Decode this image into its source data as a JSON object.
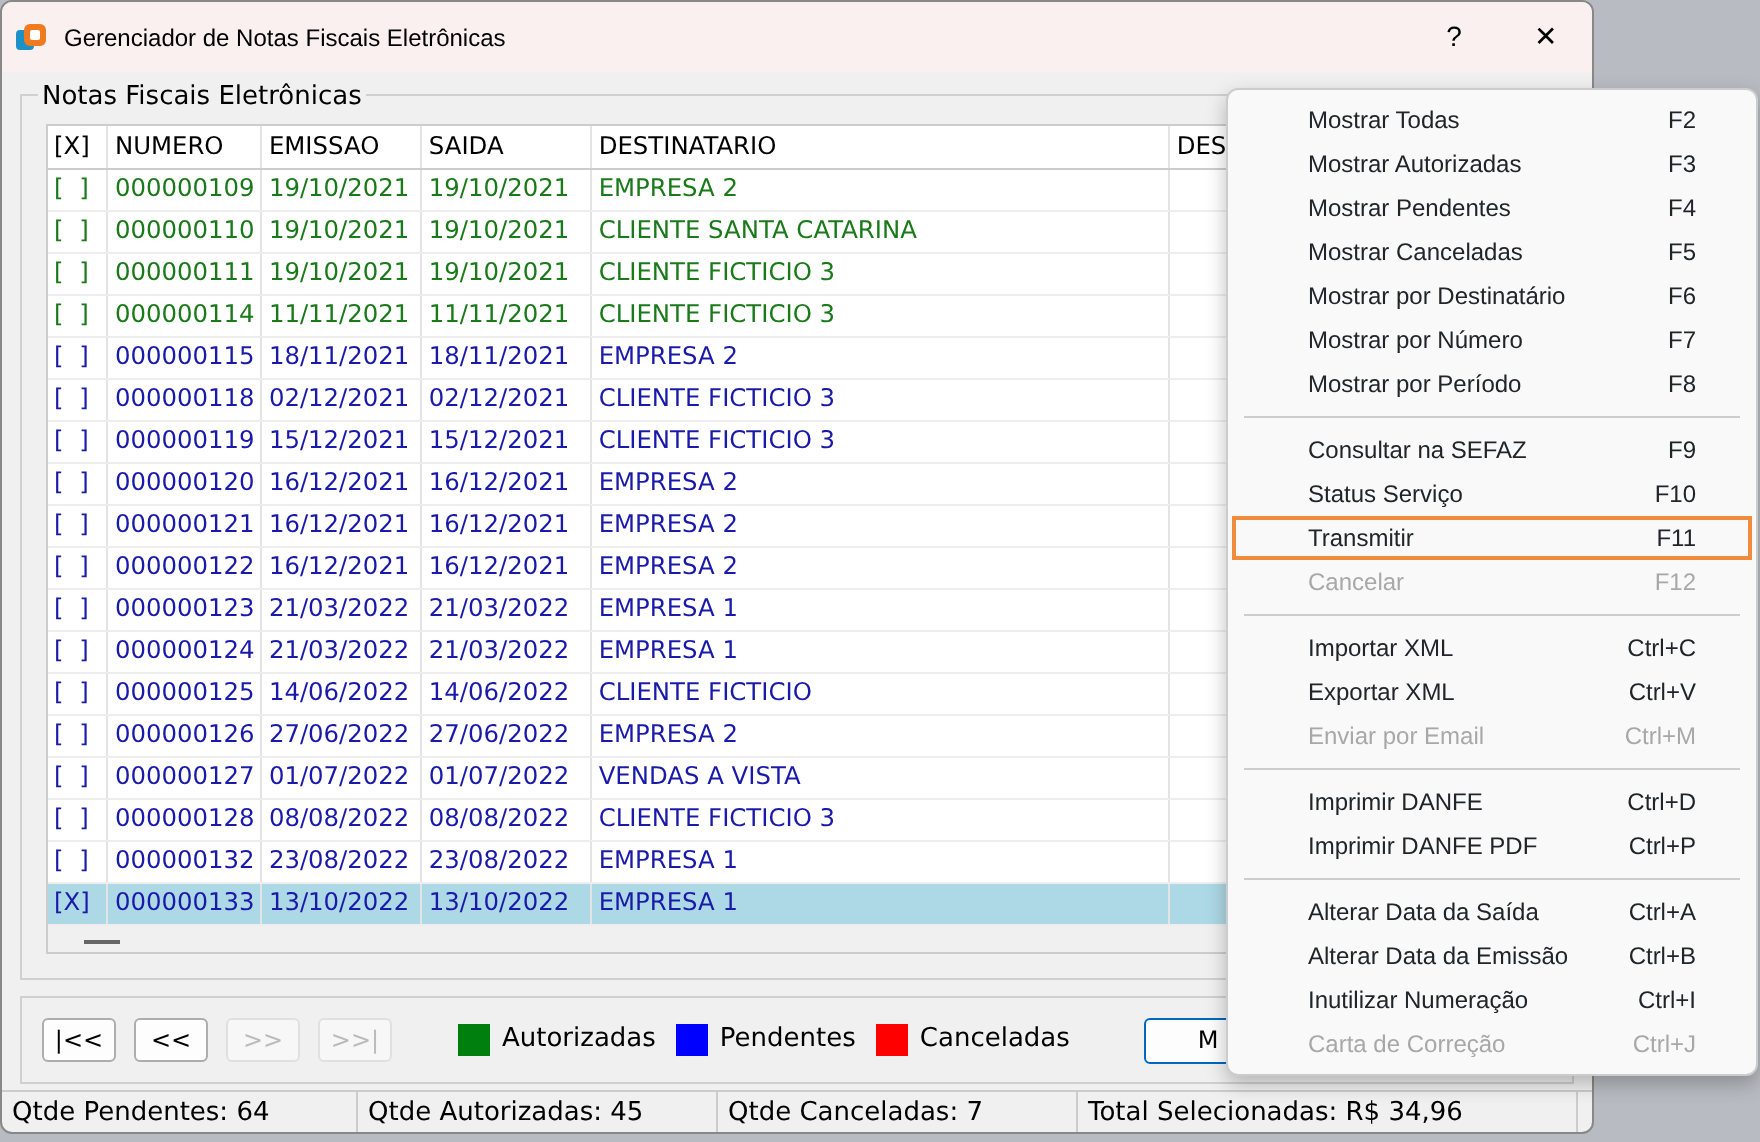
{
  "window": {
    "title": "Gerenciador de Notas Fiscais Eletrônicas",
    "help_button": "?",
    "close_button": "✕"
  },
  "group_title": "Notas Fiscais Eletrônicas",
  "table": {
    "columns": [
      "[X]",
      "NUMERO",
      "EMISSAO",
      "SAIDA",
      "DESTINATARIO",
      "DES"
    ],
    "rows": [
      {
        "checked": false,
        "selected": false,
        "color": "#1a7a1a",
        "cells": [
          "[ ]",
          "000000109",
          "19/10/2021",
          "19/10/2021",
          "EMPRESA 2"
        ]
      },
      {
        "checked": false,
        "selected": false,
        "color": "#1a7a1a",
        "cells": [
          "[ ]",
          "000000110",
          "19/10/2021",
          "19/10/2021",
          "CLIENTE SANTA CATARINA"
        ]
      },
      {
        "checked": false,
        "selected": false,
        "color": "#1a7a1a",
        "cells": [
          "[ ]",
          "000000111",
          "19/10/2021",
          "19/10/2021",
          "CLIENTE FICTICIO 3"
        ]
      },
      {
        "checked": false,
        "selected": false,
        "color": "#1a7a1a",
        "cells": [
          "[ ]",
          "000000114",
          "11/11/2021",
          "11/11/2021",
          "CLIENTE FICTICIO 3"
        ]
      },
      {
        "checked": false,
        "selected": false,
        "color": "#1a1aaa",
        "cells": [
          "[ ]",
          "000000115",
          "18/11/2021",
          "18/11/2021",
          "EMPRESA 2"
        ]
      },
      {
        "checked": false,
        "selected": false,
        "color": "#1a1aaa",
        "cells": [
          "[ ]",
          "000000118",
          "02/12/2021",
          "02/12/2021",
          "CLIENTE FICTICIO 3"
        ]
      },
      {
        "checked": false,
        "selected": false,
        "color": "#1a1aaa",
        "cells": [
          "[ ]",
          "000000119",
          "15/12/2021",
          "15/12/2021",
          "CLIENTE FICTICIO 3"
        ]
      },
      {
        "checked": false,
        "selected": false,
        "color": "#1a1aaa",
        "cells": [
          "[ ]",
          "000000120",
          "16/12/2021",
          "16/12/2021",
          "EMPRESA 2"
        ]
      },
      {
        "checked": false,
        "selected": false,
        "color": "#1a1aaa",
        "cells": [
          "[ ]",
          "000000121",
          "16/12/2021",
          "16/12/2021",
          "EMPRESA 2"
        ]
      },
      {
        "checked": false,
        "selected": false,
        "color": "#1a1aaa",
        "cells": [
          "[ ]",
          "000000122",
          "16/12/2021",
          "16/12/2021",
          "EMPRESA 2"
        ]
      },
      {
        "checked": false,
        "selected": false,
        "color": "#1a1aaa",
        "cells": [
          "[ ]",
          "000000123",
          "21/03/2022",
          "21/03/2022",
          "EMPRESA 1"
        ]
      },
      {
        "checked": false,
        "selected": false,
        "color": "#1a1aaa",
        "cells": [
          "[ ]",
          "000000124",
          "21/03/2022",
          "21/03/2022",
          "EMPRESA 1"
        ]
      },
      {
        "checked": false,
        "selected": false,
        "color": "#1a1aaa",
        "cells": [
          "[ ]",
          "000000125",
          "14/06/2022",
          "14/06/2022",
          "CLIENTE FICTICIO"
        ]
      },
      {
        "checked": false,
        "selected": false,
        "color": "#1a1aaa",
        "cells": [
          "[ ]",
          "000000126",
          "27/06/2022",
          "27/06/2022",
          "EMPRESA 2"
        ]
      },
      {
        "checked": false,
        "selected": false,
        "color": "#1a1aaa",
        "cells": [
          "[ ]",
          "000000127",
          "01/07/2022",
          "01/07/2022",
          "VENDAS A VISTA"
        ]
      },
      {
        "checked": false,
        "selected": false,
        "color": "#1a1aaa",
        "cells": [
          "[ ]",
          "000000128",
          "08/08/2022",
          "08/08/2022",
          "CLIENTE FICTICIO 3"
        ]
      },
      {
        "checked": false,
        "selected": false,
        "color": "#1a1aaa",
        "cells": [
          "[ ]",
          "000000132",
          "23/08/2022",
          "23/08/2022",
          "EMPRESA 1"
        ]
      },
      {
        "checked": true,
        "selected": true,
        "color": "#1a1aaa",
        "cells": [
          "[X]",
          "000000133",
          "13/10/2022",
          "13/10/2022",
          "EMPRESA 1"
        ]
      }
    ]
  },
  "nav_buttons": [
    {
      "label": "|<<",
      "disabled": false
    },
    {
      "label": "<<",
      "disabled": false
    },
    {
      "label": ">>",
      "disabled": true
    },
    {
      "label": ">>|",
      "disabled": true
    }
  ],
  "legend": [
    {
      "label": "Autorizadas",
      "color": "#007f0e"
    },
    {
      "label": "Pendentes",
      "color": "#0000ff"
    },
    {
      "label": "Canceladas",
      "color": "#ff0000"
    }
  ],
  "action_button": "M",
  "status_bar": [
    "Qtde Pendentes: 64",
    "Qtde Autorizadas: 45",
    "Qtde Canceladas: 7",
    "Total Selecionadas: R$ 34,96"
  ],
  "context_menu": [
    [
      {
        "label": "Mostrar Todas",
        "shortcut": "F2",
        "disabled": false,
        "selected": false
      },
      {
        "label": "Mostrar Autorizadas",
        "shortcut": "F3",
        "disabled": false,
        "selected": false
      },
      {
        "label": "Mostrar Pendentes",
        "shortcut": "F4",
        "disabled": false,
        "selected": false
      },
      {
        "label": "Mostrar Canceladas",
        "shortcut": "F5",
        "disabled": false,
        "selected": false
      },
      {
        "label": "Mostrar por Destinatário",
        "shortcut": "F6",
        "disabled": false,
        "selected": false
      },
      {
        "label": "Mostrar por Número",
        "shortcut": "F7",
        "disabled": false,
        "selected": false
      },
      {
        "label": "Mostrar por Período",
        "shortcut": "F8",
        "disabled": false,
        "selected": false
      }
    ],
    [
      {
        "label": "Consultar na SEFAZ",
        "shortcut": "F9",
        "disabled": false,
        "selected": false
      },
      {
        "label": "Status Serviço",
        "shortcut": "F10",
        "disabled": false,
        "selected": false
      },
      {
        "label": "Transmitir",
        "shortcut": "F11",
        "disabled": false,
        "selected": true
      },
      {
        "label": "Cancelar",
        "shortcut": "F12",
        "disabled": true,
        "selected": false
      }
    ],
    [
      {
        "label": "Importar XML",
        "shortcut": "Ctrl+C",
        "disabled": false,
        "selected": false
      },
      {
        "label": "Exportar XML",
        "shortcut": "Ctrl+V",
        "disabled": false,
        "selected": false
      },
      {
        "label": "Enviar por Email",
        "shortcut": "Ctrl+M",
        "disabled": true,
        "selected": false
      }
    ],
    [
      {
        "label": "Imprimir DANFE",
        "shortcut": "Ctrl+D",
        "disabled": false,
        "selected": false
      },
      {
        "label": "Imprimir DANFE PDF",
        "shortcut": "Ctrl+P",
        "disabled": false,
        "selected": false
      }
    ],
    [
      {
        "label": "Alterar Data da Saída",
        "shortcut": "Ctrl+A",
        "disabled": false,
        "selected": false
      },
      {
        "label": "Alterar Data da Emissão",
        "shortcut": "Ctrl+B",
        "disabled": false,
        "selected": false
      },
      {
        "label": "Inutilizar Numeração",
        "shortcut": "Ctrl+I",
        "disabled": false,
        "selected": false
      },
      {
        "label": "Carta de Correção",
        "shortcut": "Ctrl+J",
        "disabled": true,
        "selected": false
      }
    ]
  ]
}
